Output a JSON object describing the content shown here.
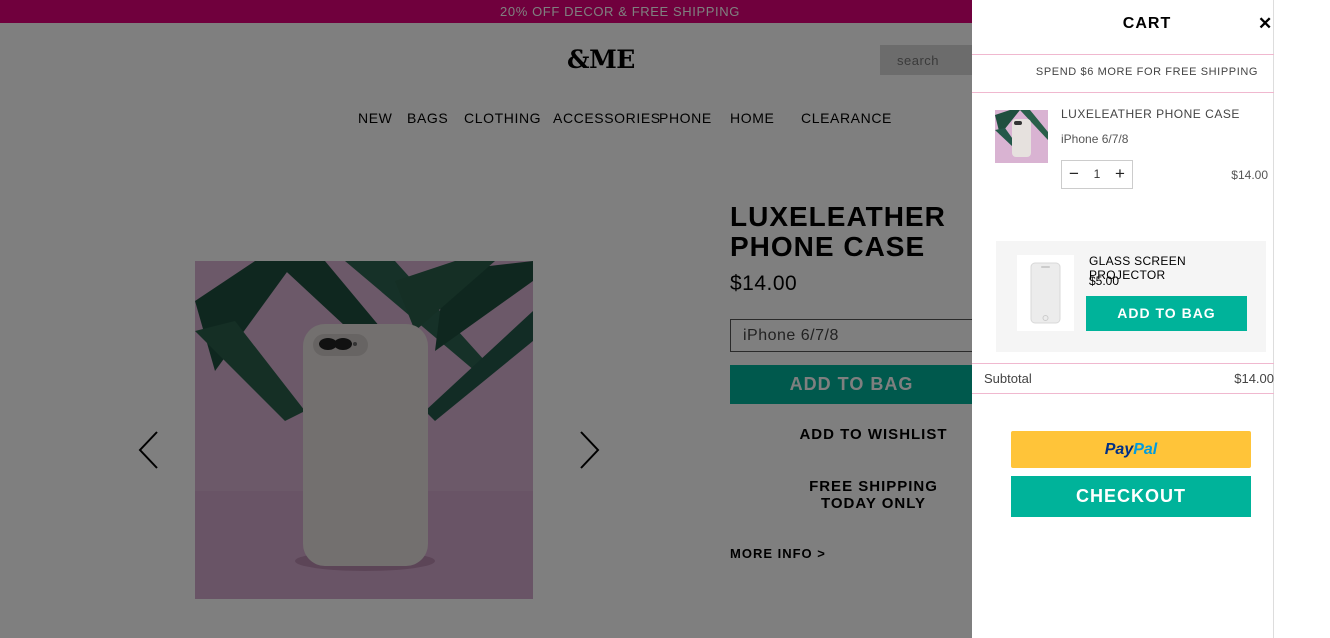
{
  "promo": {
    "text": "20% OFF DECOR & FREE SHIPPING"
  },
  "header": {
    "logo": "&ME",
    "search_placeholder": "search"
  },
  "nav": {
    "items": [
      "NEW",
      "BAGS",
      "CLOTHING",
      "ACCESSORIES",
      "PHONE",
      "HOME",
      "CLEARANCE"
    ]
  },
  "product": {
    "title": "LUXELEATHER PHONE CASE",
    "price": "$14.00",
    "variant": "iPhone 6/7/8",
    "add_to_bag": "ADD TO BAG",
    "add_to_wishlist": "ADD TO WISHLIST",
    "shipping_line1": "FREE SHIPPING",
    "shipping_line2": "TODAY ONLY",
    "more_info": "MORE INFO >"
  },
  "cart": {
    "title": "CART",
    "close_icon": "close-icon",
    "free_shipping_msg": "SPEND $6 MORE FOR FREE SHIPPING",
    "items": [
      {
        "name": "LUXELEATHER PHONE CASE",
        "variant": "iPhone 6/7/8",
        "quantity": "1",
        "price": "$14.00"
      }
    ],
    "upsell": {
      "name": "GLASS SCREEN PROJECTOR",
      "price": "$5.00",
      "add_label": "ADD TO BAG"
    },
    "subtotal_label": "Subtotal",
    "subtotal_value": "$14.00",
    "paypal_label_a": "Pay",
    "paypal_label_b": "Pal",
    "checkout_label": "CHECKOUT"
  },
  "colors": {
    "promo_bg": "#e0007a",
    "accent_green": "#00b39a",
    "paypal_yellow": "#ffc439",
    "divider_pink": "#f0b8cf"
  }
}
